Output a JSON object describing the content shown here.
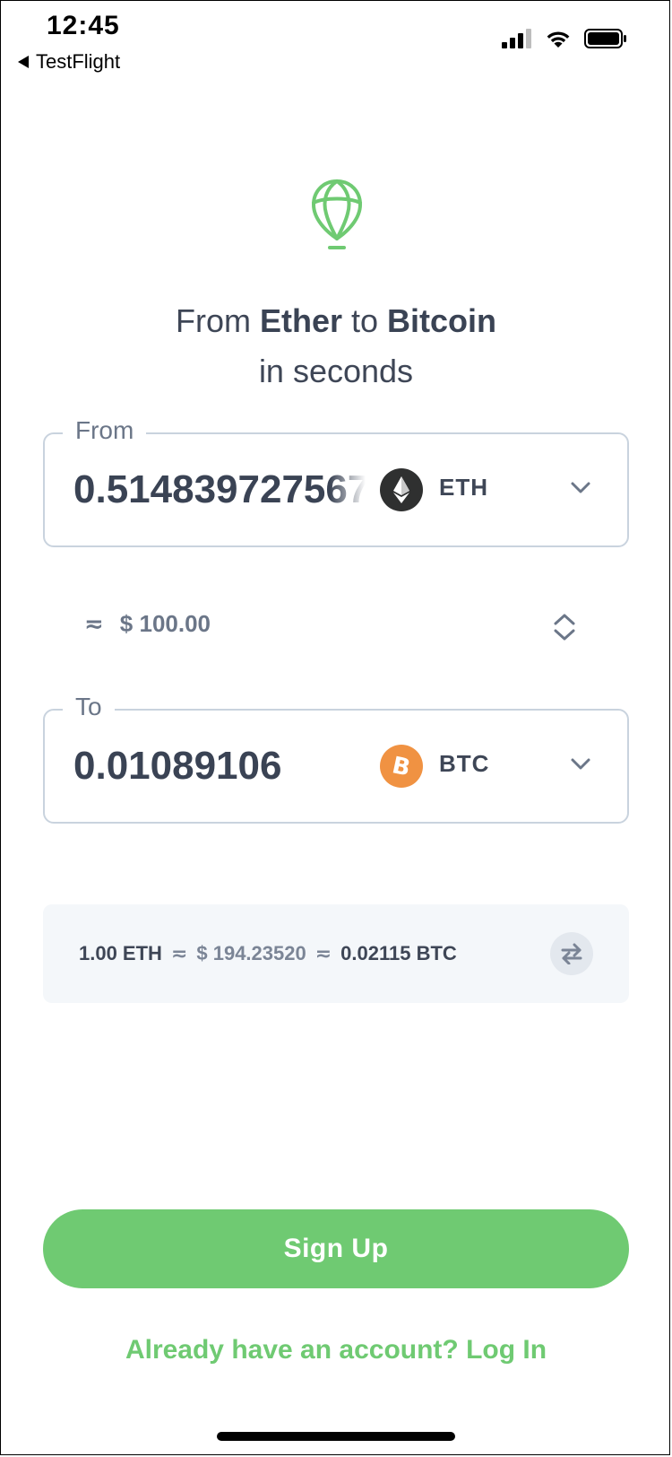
{
  "status_bar": {
    "time": "12:45",
    "back_app": "TestFlight",
    "icons": [
      "cellular-signal-icon",
      "wifi-icon",
      "battery-icon"
    ]
  },
  "logo": {
    "icon": "balloon-logo-icon",
    "color": "#6fca72"
  },
  "headline": {
    "line1_prefix": "From ",
    "from_coin": "Ether",
    "line1_mid": " to ",
    "to_coin": "Bitcoin",
    "line2": "in seconds"
  },
  "from_field": {
    "legend": "From",
    "amount": "0.514839727567",
    "coin_code": "ETH",
    "icon": "ethereum-icon"
  },
  "usd_row": {
    "approx_symbol": "≂",
    "value": "$ 100.00",
    "toggle_icon": "up-down-chevron-icon"
  },
  "to_field": {
    "legend": "To",
    "amount": "0.01089106",
    "coin_code": "BTC",
    "icon": "bitcoin-icon"
  },
  "rate": {
    "eth": "1.00 ETH",
    "approx1": "≂",
    "usd": "$ 194.23520",
    "approx2": "≂",
    "btc": "0.02115 BTC",
    "swap_icon": "swap-arrows-icon"
  },
  "actions": {
    "signup_label": "Sign Up",
    "login_label": "Already have an account? Log In"
  },
  "colors": {
    "accent": "#6fca72",
    "text": "#3e4656",
    "muted": "#6b7688",
    "border": "#c9d3de",
    "eth_icon_bg": "#2f3030",
    "btc_icon_bg": "#f09242"
  }
}
